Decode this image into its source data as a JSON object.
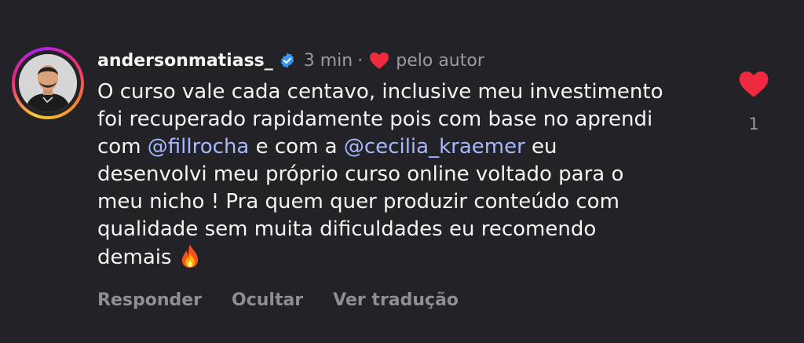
{
  "comment": {
    "username": "andersonmatiass_",
    "time": "3 min",
    "separator": "·",
    "liked_by_author": "pelo autor",
    "lines": [
      {
        "segments": [
          {
            "text": "O curso vale cada centavo, inclusive meu investimento",
            "type": "text"
          }
        ]
      },
      {
        "segments": [
          {
            "text": "foi recuperado rapidamente pois com base no aprendi",
            "type": "text"
          }
        ]
      },
      {
        "segments": [
          {
            "text": "com ",
            "type": "text"
          },
          {
            "text": "@fillrocha",
            "type": "mention"
          },
          {
            "text": " e com a ",
            "type": "text"
          },
          {
            "text": "@cecilia_kraemer",
            "type": "mention"
          },
          {
            "text": " eu",
            "type": "text"
          }
        ]
      },
      {
        "segments": [
          {
            "text": "desenvolvi meu próprio curso online voltado para o",
            "type": "text"
          }
        ]
      },
      {
        "segments": [
          {
            "text": "meu nicho ! Pra quem quer produzir conteúdo com",
            "type": "text"
          }
        ]
      },
      {
        "segments": [
          {
            "text": "qualidade sem muita dificuldades eu recomendo",
            "type": "text"
          }
        ]
      },
      {
        "segments": [
          {
            "text": "demais",
            "type": "text"
          }
        ],
        "trailing_icon": "fire-emoji"
      }
    ],
    "like_count": "1"
  },
  "actions": {
    "reply": "Responder",
    "hide": "Ocultar",
    "translate": "Ver tradução"
  },
  "icons": {
    "verified": "verified-badge-icon",
    "author_heart": "heart-icon",
    "like": "heart-icon",
    "emoji": "fire-emoji"
  },
  "colors": {
    "background": "#232327",
    "text": "#f5f5f5",
    "muted": "#9a9a9f",
    "mention": "#a9b7ff",
    "heart": "#ef2a3f",
    "verified": "#3797f0"
  }
}
